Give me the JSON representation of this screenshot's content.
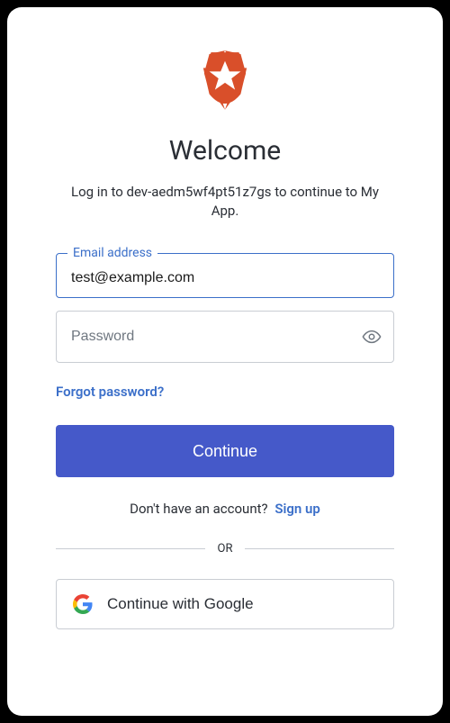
{
  "title": "Welcome",
  "subtitle": "Log in to dev-aedm5wf4pt51z7gs to continue to My App.",
  "email": {
    "label": "Email address",
    "value": "test@example.com"
  },
  "password": {
    "placeholder": "Password",
    "value": ""
  },
  "forgot_label": "Forgot password?",
  "continue_label": "Continue",
  "signup_prompt": "Don't have an account?",
  "signup_label": "Sign up",
  "divider_label": "OR",
  "google_label": "Continue with Google"
}
